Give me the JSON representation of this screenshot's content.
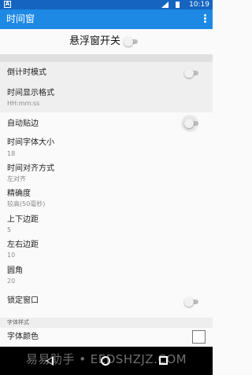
{
  "status_bar": {
    "time": "10:19",
    "notification_icon": "a-square-icon",
    "signal_icon": "signal-icon",
    "battery_icon": "battery-icon"
  },
  "toolbar": {
    "title": "时间窗",
    "menu_icon": "more-vert-icon"
  },
  "master_switch": {
    "label": "悬浮窗开关",
    "on": false
  },
  "settings": {
    "countdown": {
      "title": "倒计时模式",
      "on": false
    },
    "time_format": {
      "title": "时间显示格式",
      "summary": "HH:mm:ss"
    },
    "auto_snap": {
      "title": "自动贴边",
      "on": false
    },
    "font_size": {
      "title": "时间字体大小",
      "summary": "18"
    },
    "alignment": {
      "title": "时间对齐方式",
      "summary": "左对齐"
    },
    "precision": {
      "title": "精确度",
      "summary": "较高(50毫秒)"
    },
    "vertical_margin": {
      "title": "上下边距",
      "summary": "5"
    },
    "horizontal_margin": {
      "title": "左右边距",
      "summary": "10"
    },
    "corner_radius": {
      "title": "圆角",
      "summary": "20"
    },
    "lock_window": {
      "title": "锁定窗口",
      "on": false
    }
  },
  "font_style_section": {
    "header": "字体样式",
    "font_color": {
      "title": "字体颜色",
      "color": "#ffffff"
    }
  },
  "watermark": "易易助手 • EEDSHZJZ.COM",
  "colors": {
    "status_bar": "#1565c0",
    "toolbar": "#1e88e5",
    "background": "#fafafa"
  }
}
